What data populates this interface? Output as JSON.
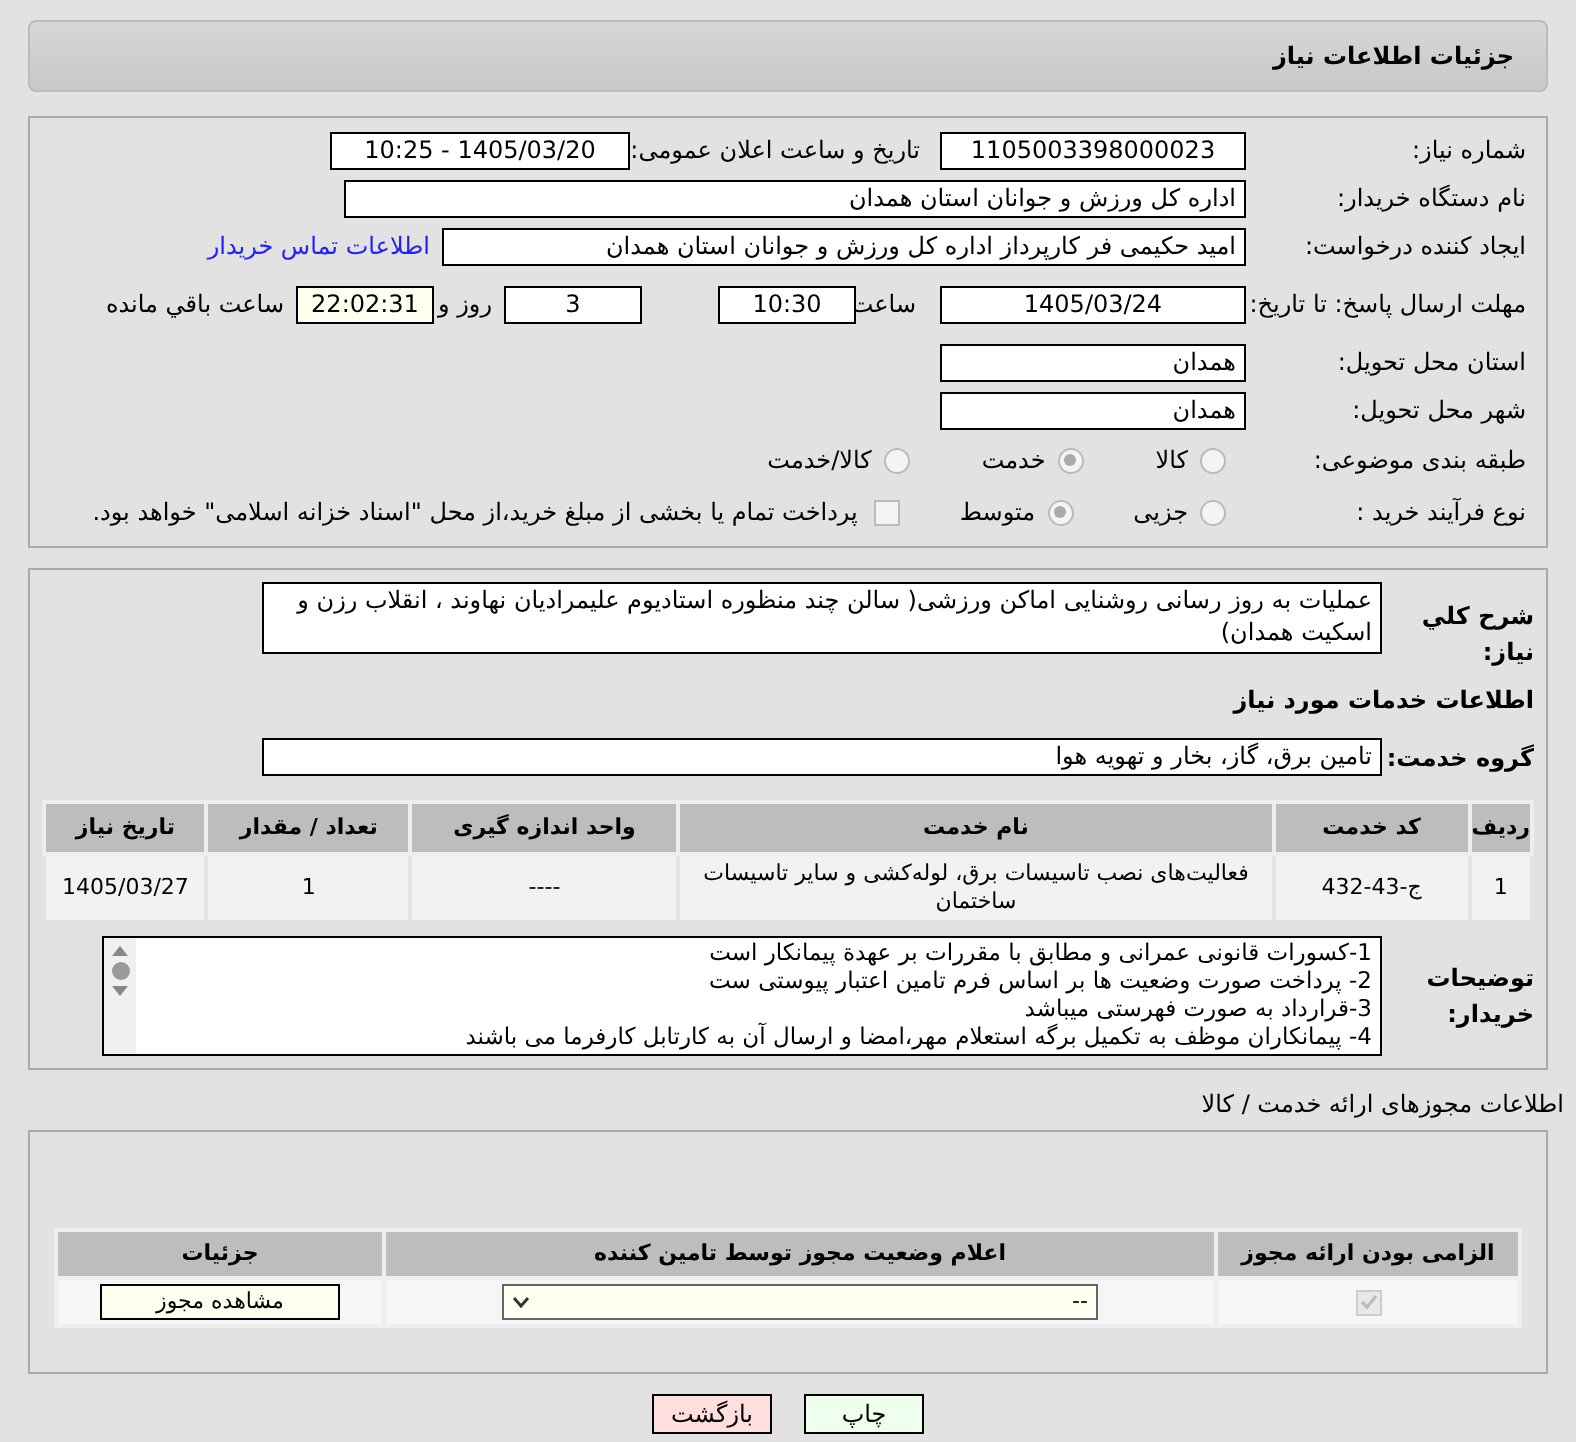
{
  "header": {
    "title": "جزئیات اطلاعات نیاز"
  },
  "form": {
    "need_number": {
      "label": "شماره نیاز:",
      "value": "1105003398000023"
    },
    "announce": {
      "label": "تاریخ و ساعت اعلان عمومی:",
      "value": "1405/03/20 - 10:25"
    },
    "buyer": {
      "label": "نام دستگاه خریدار:",
      "value": "اداره کل ورزش و جوانان استان همدان"
    },
    "creator": {
      "label": "ایجاد کننده درخواست:",
      "value": "امید حکیمی فر کارپرداز اداره کل ورزش و جوانان استان همدان",
      "link": "اطلاعات تماس خریدار"
    },
    "deadline": {
      "label": "مهلت ارسال پاسخ: تا تاریخ:",
      "date": "1405/03/24",
      "time_label": "ساعت",
      "time": "10:30",
      "days": "3",
      "days_label": "روز و",
      "remaining": "22:02:31",
      "remaining_label": "ساعت باقي مانده"
    },
    "province": {
      "label": "استان محل تحویل:",
      "value": "همدان"
    },
    "city": {
      "label": "شهر محل تحویل:",
      "value": "همدان"
    },
    "category": {
      "label": "طبقه بندی موضوعی:",
      "options": [
        {
          "label": "کالا",
          "selected": false
        },
        {
          "label": "خدمت",
          "selected": true
        },
        {
          "label": "کالا/خدمت",
          "selected": false
        }
      ]
    },
    "process": {
      "label": "نوع فرآیند خرید :",
      "options": [
        {
          "label": "جزیی",
          "selected": false
        },
        {
          "label": "متوسط",
          "selected": true
        }
      ],
      "treasury": {
        "label": "پرداخت تمام یا بخشی از مبلغ خرید،از محل \"اسناد خزانه اسلامی\" خواهد بود.",
        "checked": false
      }
    }
  },
  "details": {
    "summary": {
      "label": "شرح كلي نياز:",
      "value": "عملیات به روز رسانی روشنایی اماکن ورزشی( سالن چند منظوره استادیوم علیمرادیان نهاوند ، انقلاب رزن و اسکیت همدان)"
    },
    "services_heading": "اطلاعات خدمات مورد نیاز",
    "service_group": {
      "label": "گروه خدمت:",
      "value": "تامین برق، گاز، بخار و تهویه هوا"
    },
    "table": {
      "columns": [
        "ردیف",
        "کد خدمت",
        "نام خدمت",
        "واحد اندازه گیری",
        "تعداد / مقدار",
        "تاریخ نیاز"
      ],
      "rows": [
        [
          "1",
          "ج-43-432",
          "فعالیت‌های نصب تاسیسات برق، لوله‌کشی و سایر تاسیسات ساختمان",
          "----",
          "1",
          "1405/03/27"
        ]
      ]
    },
    "buyer_notes": {
      "label": "توضیحات خریدار:",
      "lines": [
        "1-کسورات قانونی عمرانی و مطابق با مقررات بر عهدة پیمانکار است",
        "2- پرداخت صورت وضعیت ها بر اساس فرم تامین اعتبار پیوستی ست",
        "3-قرارداد به صورت فهرستی میباشد",
        "4- پیمانکاران موظف به تکمیل برگه استعلام مهر،امضا و ارسال آن به کارتابل کارفرما می باشند"
      ]
    }
  },
  "permits": {
    "title": "اطلاعات مجوزهای ارائه خدمت / کالا",
    "columns": [
      "الزامی بودن ارائه مجوز",
      "اعلام وضعیت مجوز توسط تامین کننده",
      "جزئیات"
    ],
    "rows": [
      {
        "required": true,
        "status": "--",
        "action": "مشاهده مجوز"
      }
    ]
  },
  "buttons": [
    {
      "kind": "print",
      "label": "چاپ"
    },
    {
      "kind": "back",
      "label": "بازگشت"
    }
  ]
}
